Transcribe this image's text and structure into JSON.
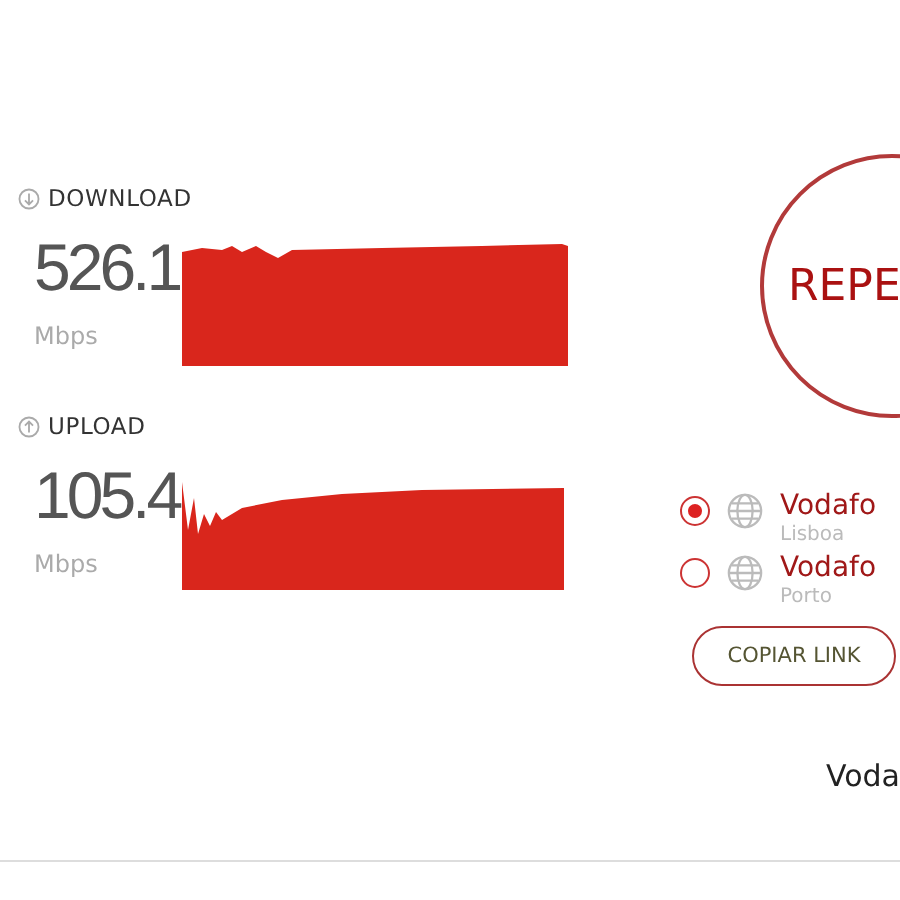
{
  "results": [
    {
      "kind": "download",
      "label": "DOWNLOAD",
      "value": "526.1",
      "unit": "Mbps"
    },
    {
      "kind": "upload",
      "label": "UPLOAD",
      "value": "105.4",
      "unit": "Mbps"
    }
  ],
  "repeat_button": {
    "label": "REPE"
  },
  "servers": [
    {
      "name": "Vodafo",
      "city": "Lisboa",
      "selected": true
    },
    {
      "name": "Vodafo",
      "city": "Porto",
      "selected": false
    }
  ],
  "copy_link_button": {
    "label": "COPIAR LINK"
  },
  "provider": "Voda"
}
